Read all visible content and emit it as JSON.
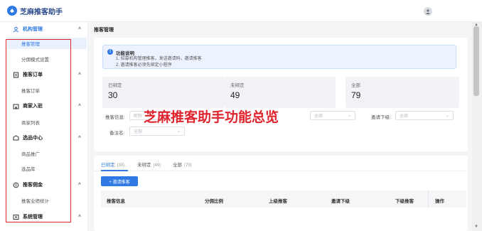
{
  "app": {
    "title": "芝麻推客助手"
  },
  "sidebar": {
    "groups": [
      {
        "label": "机构管理",
        "icon": "organization-icon",
        "items": [
          "推客管理",
          "分佣模式设置"
        ]
      },
      {
        "label": "推客订单",
        "icon": "order-icon",
        "items": [
          "推客订单"
        ]
      },
      {
        "label": "商家入驻",
        "icon": "merchant-icon",
        "items": [
          "商家列表"
        ]
      },
      {
        "label": "选品中心",
        "icon": "product-center-icon",
        "items": [
          "商品推广",
          "选品库"
        ]
      },
      {
        "label": "推客佣金",
        "icon": "commission-icon",
        "items": [
          "推客业绩统计"
        ]
      },
      {
        "label": "系统管理",
        "icon": "system-icon",
        "items": []
      }
    ],
    "active_item": "推客管理"
  },
  "main": {
    "page_title": "推客管理",
    "info": {
      "title": "功能说明",
      "lines": [
        "1. 招募机构管理推客，发送邀请码，邀请推客",
        "2. 邀请推客必须先绑定小程序"
      ]
    },
    "stats": [
      {
        "label": "已绑定",
        "value": "30"
      },
      {
        "label": "未绑定",
        "value": "49"
      },
      {
        "label": "全部",
        "value": "79"
      }
    ],
    "filters": {
      "tweeter_info_label": "推客信息:",
      "tweeter_info_placeholder": "昵称",
      "status_placeholder": "全部",
      "invite_sub_label": "邀请下级:",
      "invite_sub_placeholder": "全部",
      "remark_label": "备注名:",
      "remark_placeholder": "全部"
    },
    "tabs": [
      {
        "label": "已绑定",
        "count": "(30)"
      },
      {
        "label": "未绑定",
        "count": "(49)"
      },
      {
        "label": "全部",
        "count": "(79)"
      }
    ],
    "invite_button": "+ 邀请推客",
    "table": {
      "headers": [
        "推客信息",
        "分佣比例",
        "上级推客",
        "邀请下级",
        "下级推客",
        "操作"
      ]
    }
  },
  "overlay_text": "芝麻推客助手功能总览",
  "colors": {
    "accent": "#2f7ae5",
    "annotation": "#e0242e"
  }
}
